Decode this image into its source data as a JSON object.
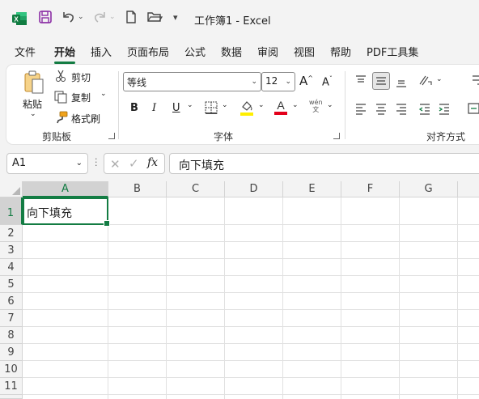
{
  "window": {
    "title": "工作簿1  -  Excel"
  },
  "menu": {
    "items": [
      "文件",
      "开始",
      "插入",
      "页面布局",
      "公式",
      "数据",
      "审阅",
      "视图",
      "帮助",
      "PDF工具集"
    ],
    "active_index": 1
  },
  "ribbon": {
    "clipboard": {
      "paste": "粘贴",
      "cut": "剪切",
      "copy": "复制",
      "format_painter": "格式刷",
      "label": "剪贴板"
    },
    "font": {
      "family": "等线",
      "size": "12",
      "label": "字体",
      "phonetic": "wén",
      "bold": "B",
      "italic": "I",
      "underline": "U"
    },
    "alignment": {
      "label": "对齐方式"
    }
  },
  "formula_bar": {
    "name_box": "A1",
    "fx": "fx",
    "value": "向下填充"
  },
  "sheet": {
    "columns": [
      "A",
      "B",
      "C",
      "D",
      "E",
      "F",
      "G"
    ],
    "rows": [
      "1",
      "2",
      "3",
      "4",
      "5",
      "6",
      "7",
      "8",
      "9",
      "10",
      "11"
    ],
    "cells": {
      "A1": "向下填充"
    },
    "selected": "A1"
  },
  "colors": {
    "accent": "#137c43",
    "excel_green": "#107c41",
    "highlight_yellow": "#ffef00",
    "font_red": "#e3001b"
  }
}
